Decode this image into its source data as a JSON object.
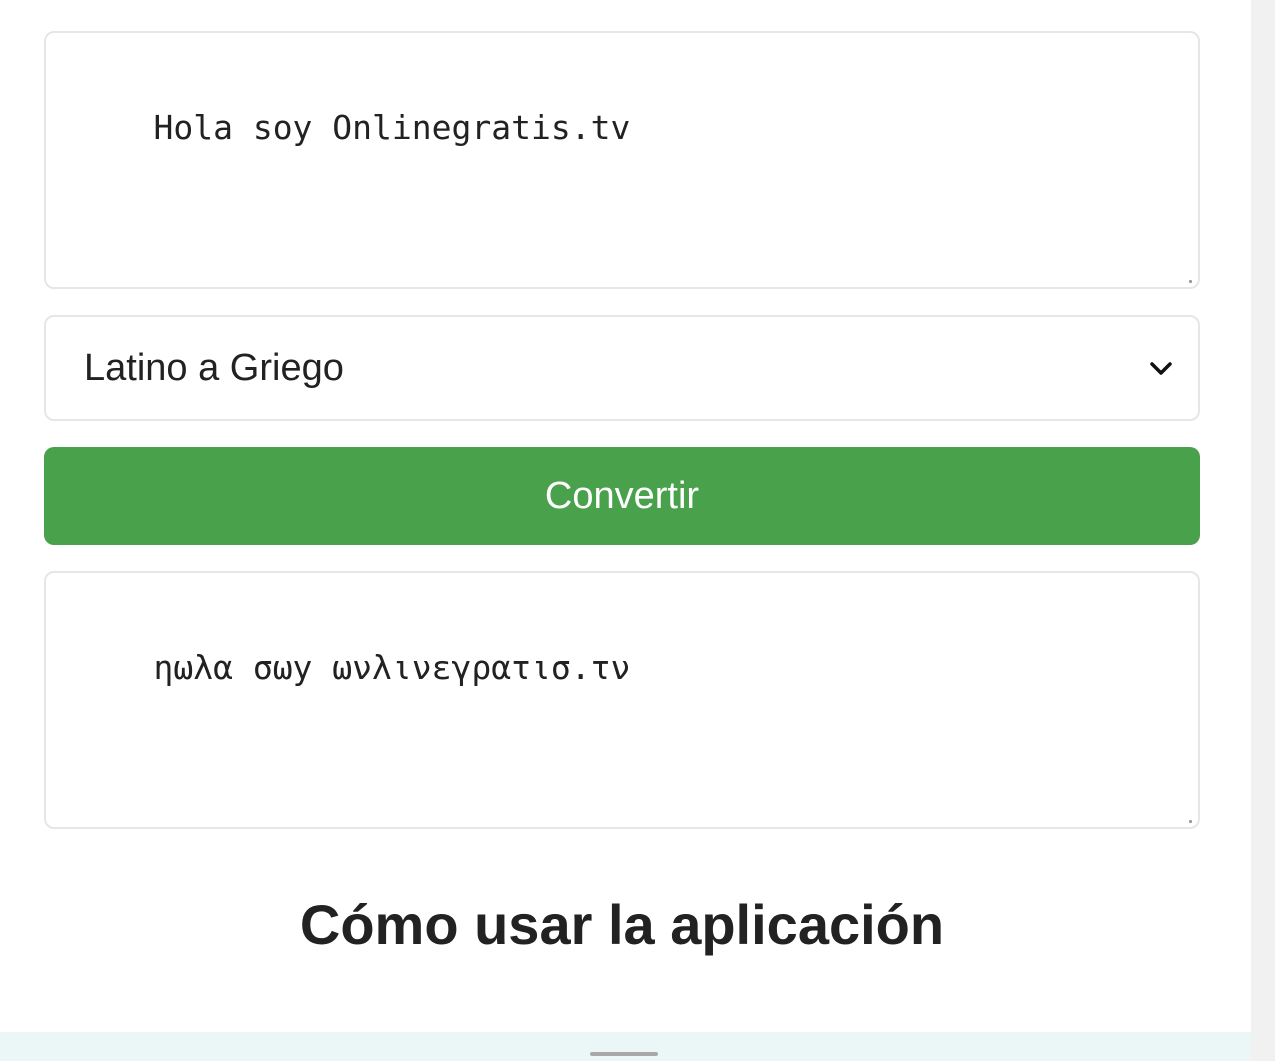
{
  "converter": {
    "input_text": "Hola soy Onlinegratis.tv",
    "mode": {
      "selected": "Latino a Griego",
      "icon": "chevron-down-icon"
    },
    "convert_label": "Convertir",
    "output_text": "ηωλα σωy ωνλινεγρατισ.τν"
  },
  "section": {
    "heading": "Cómo usar la aplicación"
  },
  "colors": {
    "button_background": "#49a14c",
    "button_text": "#ffffff",
    "field_border": "#e6e6e6",
    "text": "#222222",
    "bottom_strip": "#eaf7f6"
  }
}
